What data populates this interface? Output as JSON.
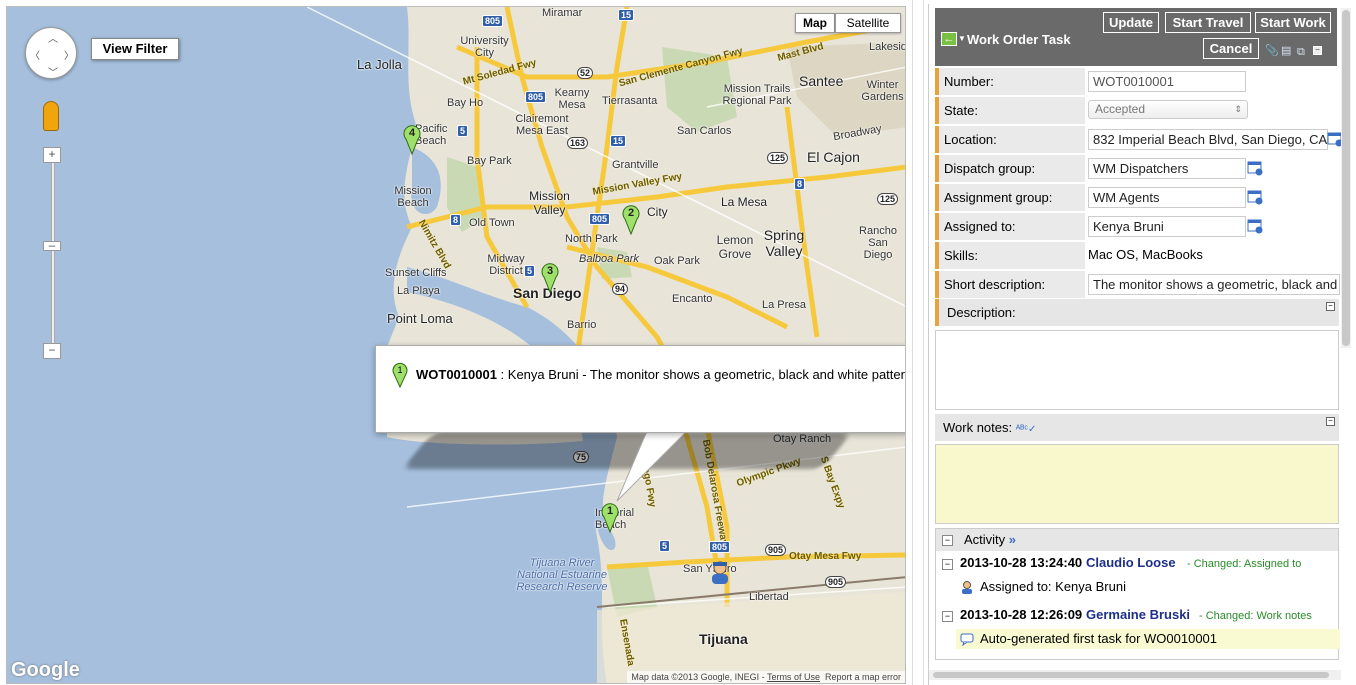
{
  "map": {
    "view_filter": "View Filter",
    "map_type_map": "Map",
    "map_type_satellite": "Satellite",
    "places": {
      "miramar": "Miramar",
      "university_city": "University City",
      "la_jolla": "La Jolla",
      "mt_soledad_fwy": "Mt Soledad Fwy",
      "san_clemente_canyon_fwy": "San Clemente Canyon Fwy",
      "mast_blvd": "Mast Blvd",
      "lakeside": "Lakeside",
      "santee": "Santee",
      "winter_gardens": "Winter Gardens",
      "bay_ho": "Bay Ho",
      "kearny_mesa": "Kearny Mesa",
      "tierrasanta": "Tierrasanta",
      "mission_trails": "Mission Trails Regional Park",
      "pacific_beach": "Pacific Beach",
      "clairemont_mesa_east": "Clairemont Mesa East",
      "san_carlos": "San Carlos",
      "broadway": "Broadway",
      "bay_park": "Bay Park",
      "grantville": "Grantville",
      "el_cajon": "El Cajon",
      "mission_valley_fwy": "Mission Valley Fwy",
      "mission_beach": "Mission Beach",
      "mission_valley": "Mission Valley",
      "city": "City",
      "la_mesa": "La Mesa",
      "old_town": "Old Town",
      "north_park": "North Park",
      "lemon_grove": "Lemon Grove",
      "spring_valley": "Spring Valley",
      "rancho_san_diego": "Rancho San Diego",
      "sunset_cliffs": "Sunset Cliffs",
      "midway_district": "Midway District",
      "balboa_park": "Balboa Park",
      "oak_park": "Oak Park",
      "la_playa": "La Playa",
      "san_diego": "San Diego",
      "encanto": "Encanto",
      "la_presa": "La Presa",
      "point_loma": "Point Loma",
      "barrio": "Barrio",
      "nimitz_blvd": "Nimitz Blvd",
      "otay_ranch": "Otay Ranch",
      "olympic_pkwy": "Olympic Pkwy",
      "s_bay_expy": "S Bay Expy",
      "imperial_beach": "Imperial Beach",
      "tijuana_river": "Tijuana River National Estuarine Research Reserve",
      "san_ysidro": "San Ysidro",
      "otay_mesa_fwy": "Otay Mesa Fwy",
      "libertad": "Libertad",
      "tijuana": "Tijuana",
      "ensenada": "Ensenada",
      "diego_fwy": "Diego Fwy",
      "bob_delarosa_fwy": "Bob Delarosa Freeway"
    },
    "shields": [
      "805",
      "15",
      "52",
      "805",
      "5",
      "163",
      "125",
      "15",
      "8",
      "805",
      "8",
      "5",
      "94",
      "125",
      "75",
      "805",
      "905",
      "905",
      "5"
    ],
    "markers": [
      "4",
      "2",
      "3",
      "1"
    ],
    "info_window": {
      "id": "WOT0010001",
      "text": " : Kenya Bruni - The monitor shows a geometric, black and white pattern"
    },
    "google_logo": "Google",
    "attribution_data": "Map data ©2013 Google, INEGI - ",
    "attribution_terms": "Terms of Use",
    "attribution_report": "Report a map error"
  },
  "form": {
    "title": "Work Order Task",
    "buttons": {
      "update": "Update",
      "start_travel": "Start Travel",
      "start_work": "Start Work",
      "cancel": "Cancel"
    },
    "fields": {
      "number_label": "Number:",
      "number_value": "WOT0010001",
      "state_label": "State:",
      "state_value": "Accepted",
      "location_label": "Location:",
      "location_value": "832 Imperial Beach Blvd, San Diego, CA",
      "dispatch_label": "Dispatch group:",
      "dispatch_value": "WM Dispatchers",
      "assignment_label": "Assignment group:",
      "assignment_value": "WM Agents",
      "assigned_label": "Assigned to:",
      "assigned_value": "Kenya Bruni",
      "skills_label": "Skills:",
      "skills_value": "Mac OS, MacBooks",
      "short_label": "Short description:",
      "short_value": "The monitor shows a geometric, black and"
    },
    "description_label": "Description:",
    "work_notes_label": "Work notes:",
    "activity": {
      "label": "Activity",
      "entries": [
        {
          "timestamp": "2013-10-28 13:24:40",
          "user": "Claudio Loose",
          "change": "- Changed:  Assigned to",
          "body": "Assigned to: Kenya Bruni"
        },
        {
          "timestamp": "2013-10-28 12:26:09",
          "user": "Germaine Bruski",
          "change": "- Changed:  Work notes",
          "body": "Auto-generated first task for WO0010001"
        }
      ]
    }
  }
}
